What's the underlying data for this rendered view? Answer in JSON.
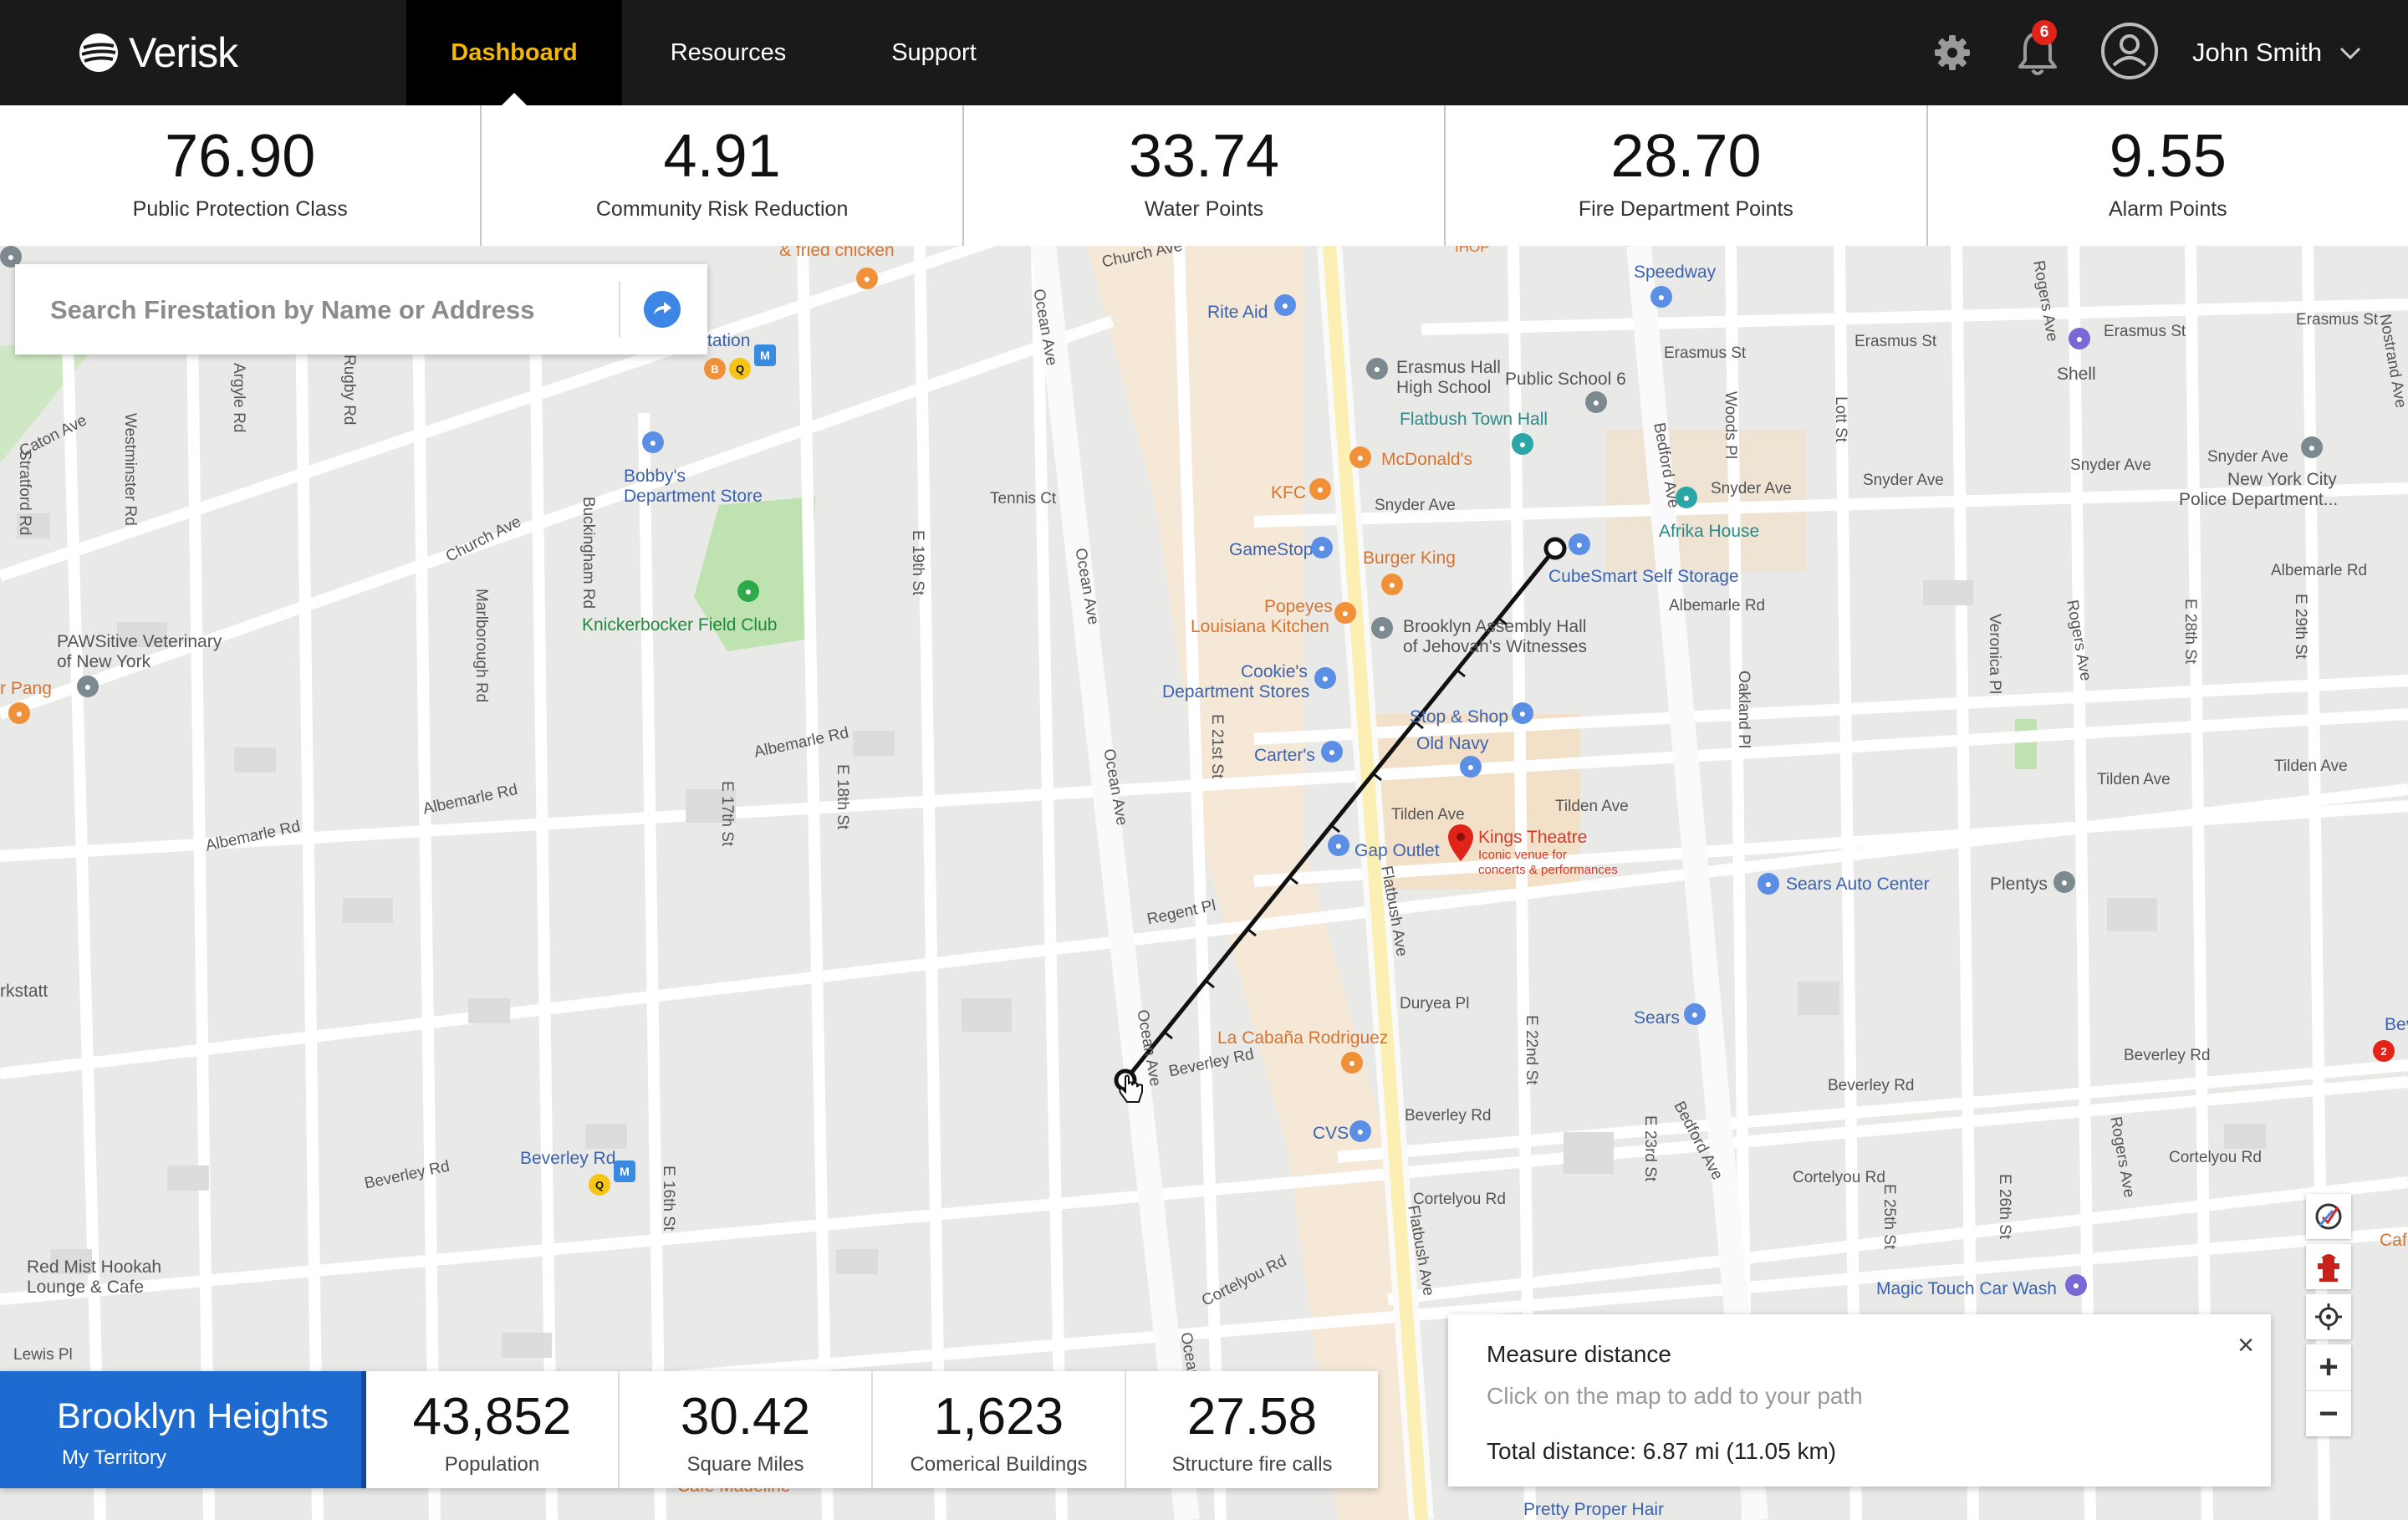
{
  "header": {
    "brand": "Verisk",
    "nav": [
      {
        "label": "Dashboard",
        "active": true
      },
      {
        "label": "Resources",
        "active": false
      },
      {
        "label": "Support",
        "active": false
      }
    ],
    "notification_count": "6",
    "user_name": "John Smith",
    "icons": [
      "gear-icon",
      "bell-icon",
      "user-avatar-icon",
      "chevron-down-icon"
    ]
  },
  "metrics": [
    {
      "value": "76.90",
      "label": "Public Protection Class"
    },
    {
      "value": "4.91",
      "label": "Community Risk Reduction"
    },
    {
      "value": "33.74",
      "label": "Water Points"
    },
    {
      "value": "28.70",
      "label": "Fire Department Points"
    },
    {
      "value": "9.55",
      "label": "Alarm Points"
    }
  ],
  "search": {
    "placeholder": "Search Firestation by Name or Address"
  },
  "map": {
    "streets": {
      "church_ave_left": "Church Ave",
      "church_ave_top": "Church Ave",
      "caton_ave": "Caton Ave",
      "tennis_ct": "Tennis Ct",
      "ocean_ave_1": "Ocean Ave",
      "ocean_ave_2": "Ocean Ave",
      "ocean_ave_3": "Ocean Ave",
      "ocean_ave_4": "Ocean Ave",
      "ocean_ave_5": "Ocean Ave",
      "flatbush_ave_1": "Flatbush Ave",
      "flatbush_ave_2": "Flatbush Ave",
      "bedford_ave_1": "Bedford Ave",
      "bedford_ave_2": "Bedford Ave",
      "rogers_ave_1": "Rogers Ave",
      "rogers_ave_2": "Rogers Ave",
      "rogers_ave_3": "Rogers Ave",
      "albemarle_rd_1": "Albemarle Rd",
      "albemarle_rd_2": "Albemarle Rd",
      "albemarle_rd_3": "Albemarle Rd",
      "albemarle_rd_4": "Albemarle Rd",
      "albemarle_rd_5": "Albemarle Rd",
      "beverley_rd_1": "Beverley Rd",
      "beverley_rd_2": "Beverley Rd",
      "beverley_rd_3": "Beverley Rd",
      "beverley_rd_4": "Beverley Rd",
      "beverley_rd_5": "Beverley Rd",
      "cortelyou_rd_1": "Cortelyou Rd",
      "cortelyou_rd_2": "Cortelyou Rd",
      "cortelyou_rd_3": "Cortelyou Rd",
      "cortelyou_rd_4": "Cortelyou Rd",
      "snyder_ave_1": "Snyder Ave",
      "snyder_ave_2": "Snyder Ave",
      "snyder_ave_3": "Snyder Ave",
      "snyder_ave_4": "Snyder Ave",
      "snyder_ave_5": "Snyder Ave",
      "erasmus_st_1": "Erasmus St",
      "erasmus_st_2": "Erasmus St",
      "erasmus_st_3": "Erasmus St",
      "erasmus_st_4": "Erasmus St",
      "tilden_ave_1": "Tilden Ave",
      "tilden_ave_2": "Tilden Ave",
      "tilden_ave_3": "Tilden Ave",
      "tilden_ave_4": "Tilden Ave",
      "regent_pl": "Regent Pl",
      "duryea_pl": "Duryea Pl",
      "lewis_pl": "Lewis Pl",
      "argyle_rd": "Argyle Rd",
      "rugby_rd": "Rugby Rd",
      "westminster_rd": "Westminster Rd",
      "stratford_rd": "Stratford Rd",
      "marlborough_rd": "Marlborough Rd",
      "buckingham_rd": "Buckingham Rd",
      "e18th": "E 18th St",
      "e19th": "E 19th St",
      "e21st": "E 21st St",
      "e22nd": "E 22nd St",
      "e17th": "E 17th St",
      "e16th": "E 16th St",
      "e23rd": "E 23rd St",
      "e25th": "E 25th St",
      "e26th": "E 26th St",
      "e28th": "E 28th St",
      "e29th": "E 29th St",
      "lott_st": "Lott St",
      "woods_pl": "Woods Pl",
      "oakland_pl": "Oakland Pl",
      "veronica_pl": "Veronica Pl",
      "nostrand_ave": "Nostrand Ave"
    },
    "pois": {
      "fried_chicken": "& fried chicken",
      "station": "tation",
      "rite_aid": "Rite Aid",
      "speedway": "Speedway",
      "erasmus_hall_1": "Erasmus Hall",
      "erasmus_hall_2": "High School",
      "public_school": "Public School 6",
      "flatbush_town_hall": "Flatbush Town Hall",
      "mcdonalds": "McDonald's",
      "kfc": "KFC",
      "gamestop": "GameStop",
      "burger_king": "Burger King",
      "popeyes_1": "Popeyes",
      "popeyes_2": "Louisiana Kitchen",
      "brooklyn_assembly_1": "Brooklyn Assembly Hall",
      "brooklyn_assembly_2": "of Jehovah's Witnesses",
      "cookies_1": "Cookie's",
      "cookies_2": "Department Stores",
      "stop_shop": "Stop & Shop",
      "old_navy": "Old Navy",
      "carters": "Carter's",
      "gap_outlet": "Gap Outlet",
      "kings_theatre": "Kings Theatre",
      "kings_theatre_desc_1": "Iconic venue for",
      "kings_theatre_desc_2": "concerts & performances",
      "cubesmart": "CubeSmart Self Storage",
      "afrika_house": "Afrika House",
      "bobbys_1": "Bobby's",
      "bobbys_2": "Department Store",
      "knickerbocker": "Knickerbocker Field Club",
      "pawsitive_1": "PAWSitive Veterinary",
      "pawsitive_2": "of New York",
      "pang": "r Pang",
      "kstatt": "rkstatt",
      "shell": "Shell",
      "nypd_1": "New York City",
      "nypd_2": "Police Department...",
      "sears_auto": "Sears Auto Center",
      "plentys": "Plentys",
      "sears": "Sears",
      "la_cabana": "La Cabaña Rodriguez",
      "cvs": "CVS",
      "beverley_rd_station": "Beverley Rd",
      "red_mist_1": "Red Mist Hookah",
      "red_mist_2": "Lounge & Cafe",
      "magic_touch": "Magic Touch Car Wash",
      "beverly_right": "Beverly",
      "caf_right": "Caf",
      "cafe_madeline": "Cafe Madeline",
      "pretty_proper": "Pretty Proper Hair",
      "ihop": "IHOP"
    }
  },
  "measure": {
    "title": "Measure distance",
    "hint": "Click on the map to add to your path",
    "total": "Total distance: 6.87 mi (11.05 km)",
    "close": "×"
  },
  "territory": {
    "name": "Brooklyn Heights",
    "subtitle": "My Territory",
    "stats": [
      {
        "value": "43,852",
        "label": "Population"
      },
      {
        "value": "30.42",
        "label": "Square Miles"
      },
      {
        "value": "1,623",
        "label": "Comerical Buildings"
      },
      {
        "value": "27.58",
        "label": "Structure fire calls"
      }
    ]
  },
  "map_controls": [
    "measure-tool-icon",
    "fire-hydrant-icon",
    "locate-icon",
    "zoom-in-button",
    "zoom-out-button"
  ],
  "colors": {
    "brand_accent": "#f5b800",
    "topbar": "#1a1a1a",
    "territory_blue": "#1d6ad0",
    "search_button": "#3c86e6"
  }
}
